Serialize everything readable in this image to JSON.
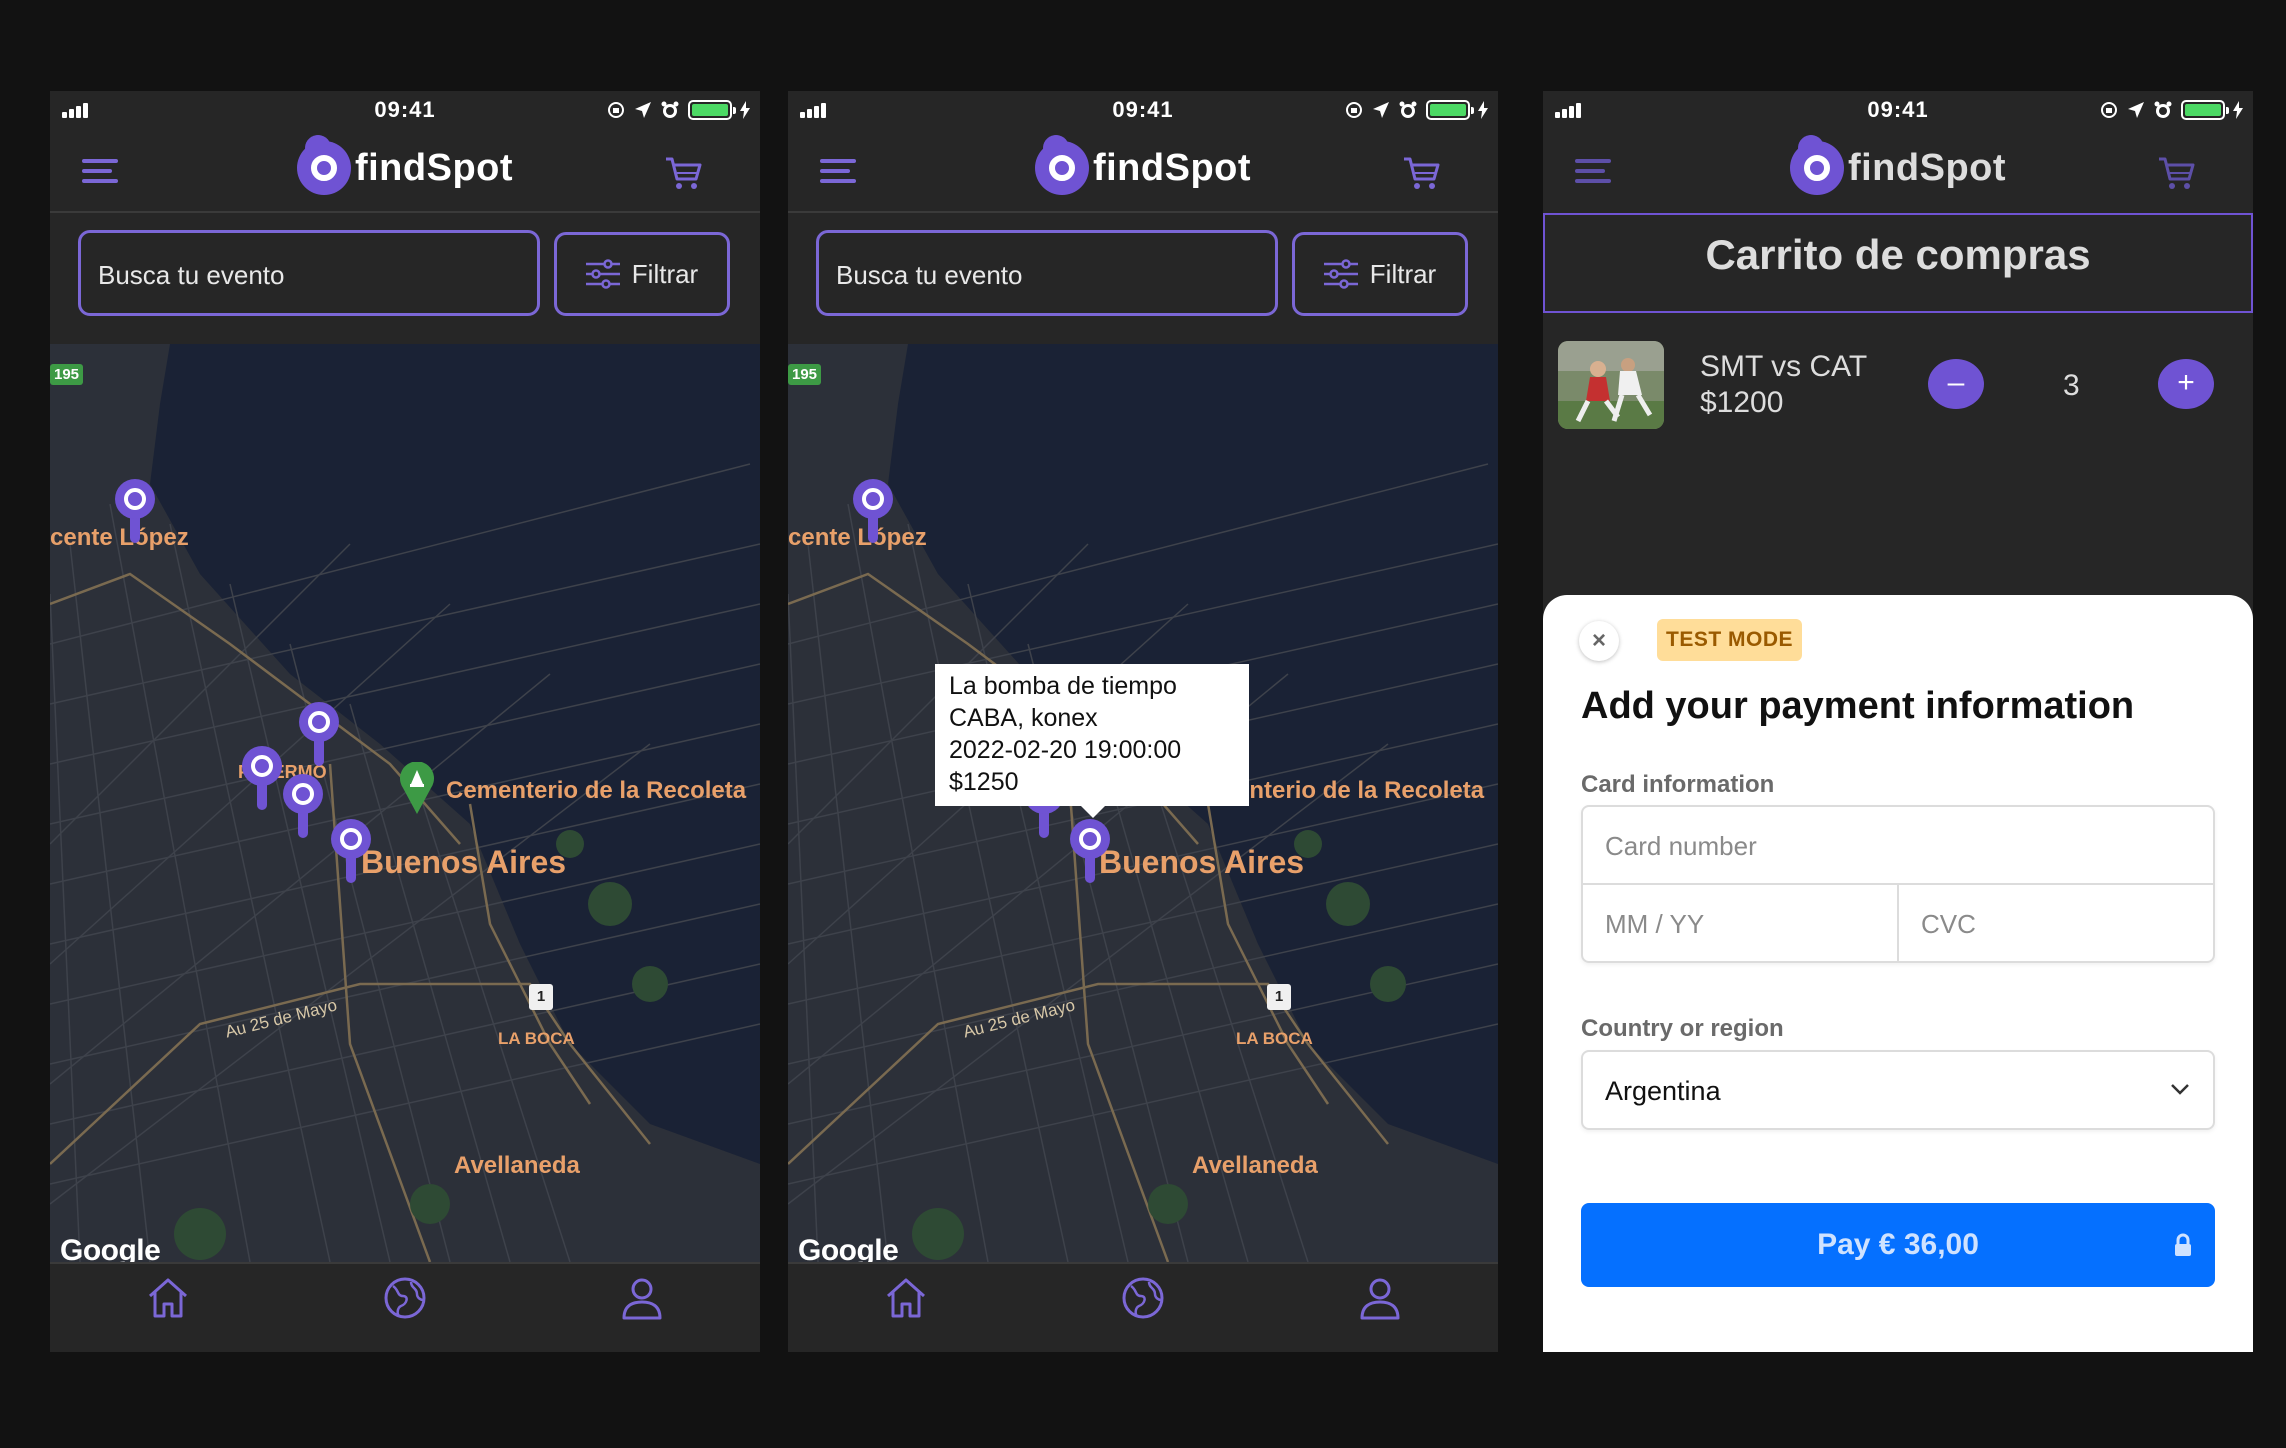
{
  "status": {
    "time": "09:41"
  },
  "app": {
    "name": "findSpot"
  },
  "search": {
    "placeholder": "Busca tu evento",
    "filter_label": "Filtrar"
  },
  "map": {
    "labels": {
      "vicente_lopez": "cente López",
      "palermo": "PALERMO",
      "recoleta": "Cementerio de la Recoleta",
      "buenos_aires": "Buenos Aires",
      "au25": "Au 25 de Mayo",
      "la_boca": "LA BOCA",
      "avellaneda": "Avellaneda",
      "route195": "195",
      "route1": "1",
      "google": "Google"
    },
    "tooltip": {
      "title": "La bomba de tiempo",
      "location": "CABA, konex",
      "datetime": "2022-02-20 19:00:00",
      "price": "$1250"
    }
  },
  "tabs": [
    "home-icon",
    "globe-icon",
    "user-icon"
  ],
  "cart": {
    "title": "Carrito de compras",
    "item": {
      "name": "SMT vs CAT",
      "price": "$1200",
      "quantity": "3",
      "minus": "–",
      "plus": "+"
    }
  },
  "payment": {
    "close": "×",
    "test_mode": "TEST MODE",
    "title": "Add your payment information",
    "card_label": "Card information",
    "card_number_placeholder": "Card number",
    "expiry_placeholder": "MM / YY",
    "cvc_placeholder": "CVC",
    "country_label": "Country or region",
    "country_value": "Argentina",
    "pay_label": "Pay € 36,00"
  },
  "colors": {
    "accent": "#6f53d3",
    "background": "#262626",
    "pay": "#0570ff",
    "map": "#1a2235",
    "map_label": "#e8a06a"
  }
}
